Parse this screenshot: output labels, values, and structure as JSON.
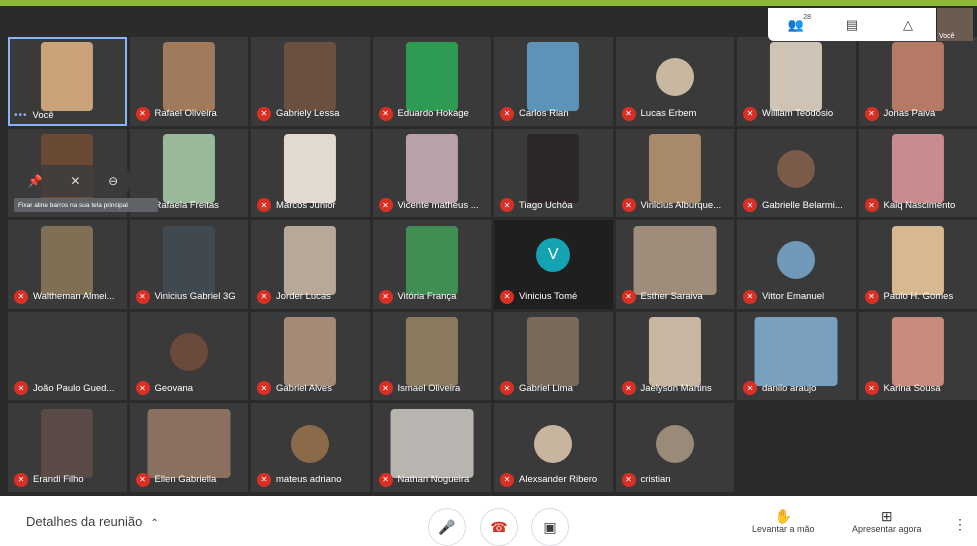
{
  "top_bar": {
    "participants_count": "28",
    "people_icon": "people-icon",
    "chat_icon": "chat-icon",
    "activities_icon": "shapes-icon",
    "self_label": "Você"
  },
  "hover_controls": {
    "pin_icon": "pin-icon",
    "mute_icon": "mic-off-icon",
    "remove_icon": "remove-icon",
    "tooltip": "Fixar aline barros na sua tela principal"
  },
  "tiles": [
    {
      "name": "Você",
      "self": true,
      "color": "#c9a27a"
    },
    {
      "name": "Rafael Oliveira",
      "color": "#a07a5a"
    },
    {
      "name": "Gabriely Lessa",
      "color": "#6a5040"
    },
    {
      "name": "Eduardo Hokage",
      "color": "#2e9a52"
    },
    {
      "name": "Carlos Rian",
      "color": "#5e93b8"
    },
    {
      "name": "Lucas Erbem",
      "color": "#c8b8a0",
      "round": true
    },
    {
      "name": "William Teodósio",
      "color": "#cfc3b5"
    },
    {
      "name": "Jonas Paiva",
      "color": "#b57a65"
    },
    {
      "name": "",
      "color": "#6b4a35"
    },
    {
      "name": "Rafaela Freitas",
      "color": "#9ab89a"
    },
    {
      "name": "Marcos Junior",
      "color": "#e2d9d0"
    },
    {
      "name": "Vicente matheus ...",
      "color": "#b8a1a8"
    },
    {
      "name": "Tiago Uchôa",
      "color": "#2d2626"
    },
    {
      "name": "Vinicius Alburque...",
      "color": "#a88a6a"
    },
    {
      "name": "Gabrielle Belarmi...",
      "color": "#7a5a48",
      "round": true
    },
    {
      "name": "Kaiq Nascimento",
      "color": "#c88b8e"
    },
    {
      "name": "Waltheman Almei...",
      "color": "#7e6f55"
    },
    {
      "name": "Vinicius Gabriel 3G",
      "color": "#404850"
    },
    {
      "name": "Jorder Lucas",
      "color": "#b8a89a"
    },
    {
      "name": "Vitória França",
      "color": "#3f8f55"
    },
    {
      "name": "Vinicius Tomé",
      "avatar": "V"
    },
    {
      "name": "Esther Saraiva",
      "color": "#a08c7a",
      "wide": true
    },
    {
      "name": "Vittor Emanuel",
      "color": "#6f98b9",
      "round": true
    },
    {
      "name": "Paulo H. Gomes",
      "color": "#d8b890"
    },
    {
      "name": "João Paulo Gued...",
      "color": "#3a3a3a"
    },
    {
      "name": "Geovana",
      "color": "#6a4a3a",
      "round": true
    },
    {
      "name": "Gabriel Alves",
      "color": "#a58a78"
    },
    {
      "name": "Ismael Oliveira",
      "color": "#8a7a60"
    },
    {
      "name": "Gabriel Lima",
      "color": "#7a6a5a"
    },
    {
      "name": "Jaelyson Martins",
      "color": "#c9b6a2"
    },
    {
      "name": "danilo araujo",
      "color": "#7aa0c0",
      "wide": true
    },
    {
      "name": "Karina Sousa",
      "color": "#c88a7a"
    },
    {
      "name": "Erandi Filho",
      "color": "#5a4a48"
    },
    {
      "name": "Ellen Gabriella",
      "color": "#8a7060",
      "wide": true
    },
    {
      "name": "mateus adriano",
      "color": "#8a6a48",
      "round": true
    },
    {
      "name": "Nathan Nogueira",
      "color": "#b8b5b0",
      "wide": true
    },
    {
      "name": "Alexsander Ribero",
      "color": "#c8b5a0",
      "round": true
    },
    {
      "name": "cristian",
      "color": "#9a8a7a",
      "round": true
    }
  ],
  "bottom_bar": {
    "details_label": "Detalhes da reunião",
    "mic_icon": "mic-icon",
    "end_call_icon": "phone-end-icon",
    "camera_icon": "camera-icon",
    "raise_hand_label": "Levantar a mão",
    "present_label": "Apresentar agora"
  }
}
